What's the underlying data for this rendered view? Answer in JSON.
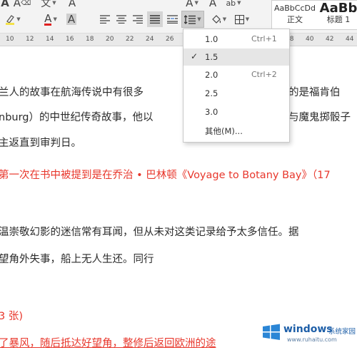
{
  "ribbon": {
    "row1": {
      "font_color_glyph": "A",
      "shrink_glyph": "A",
      "clear_glyph": "A",
      "grow_glyph": "A",
      "wen_label": "文",
      "char_shade_glyph": "A"
    },
    "row2": {
      "highlight_glyph": "A",
      "font_color2_glyph": "A",
      "char_border_glyph": "A"
    },
    "styles": [
      {
        "sample": "AaBbCcDd",
        "name": "正文"
      },
      {
        "sample": "AaBb",
        "name": "标题 1"
      }
    ]
  },
  "ruler": {
    "numbers": [
      "10",
      "12",
      "14",
      "16",
      "18",
      "20",
      "22",
      "24",
      "26",
      "28",
      "30",
      "32",
      "34",
      "36",
      "38",
      "40",
      "42",
      "44"
    ]
  },
  "line_spacing_menu": {
    "items": [
      {
        "value": "1.0",
        "shortcut": "Ctrl+1",
        "checked": false
      },
      {
        "value": "1.5",
        "shortcut": "",
        "checked": true
      },
      {
        "value": "2.0",
        "shortcut": "Ctrl+2",
        "checked": false
      },
      {
        "value": "2.5",
        "shortcut": "",
        "checked": false
      },
      {
        "value": "3.0",
        "shortcut": "",
        "checked": false
      },
      {
        "value": "其他(M)...",
        "shortcut": "",
        "checked": false
      }
    ],
    "check_glyph": "✓"
  },
  "document": {
    "lines": [
      {
        "text": "兰人的故事在航海传说中有很多",
        "color": "normal"
      },
      {
        "text": "的是福肯伯",
        "color": "normal"
      },
      {
        "text": "nburg）的中世纪传奇故事，他以",
        "color": "normal"
      },
      {
        "text": "与魔鬼掷骰子",
        "color": "normal"
      },
      {
        "text": "主返直到审判日。",
        "color": "normal"
      },
      {
        "text": "第一次在书中被提到是在乔治 • 巴林顿《Voyage to Botany Bay》（17",
        "color": "red"
      },
      {
        "text": "温崇敬幻影的迷信常有耳闻，但从未对这类记录给予太多信任。据",
        "color": "normal"
      },
      {
        "text": "望角外失事，船上无人生还。同行",
        "color": "normal"
      },
      {
        "text": "3 张)",
        "color": "red"
      },
      {
        "text": "了暴风，随后抵达好望角，整修后返回欧洲的途",
        "color": "red"
      }
    ]
  },
  "watermark": {
    "brand": "windows",
    "suffix": "系统家园",
    "url": "www.ruhaitu.com"
  },
  "colors": {
    "red_text": "#e8372c",
    "font_color_bar": "#e02020",
    "highlight_bar": "#f4e24a"
  }
}
